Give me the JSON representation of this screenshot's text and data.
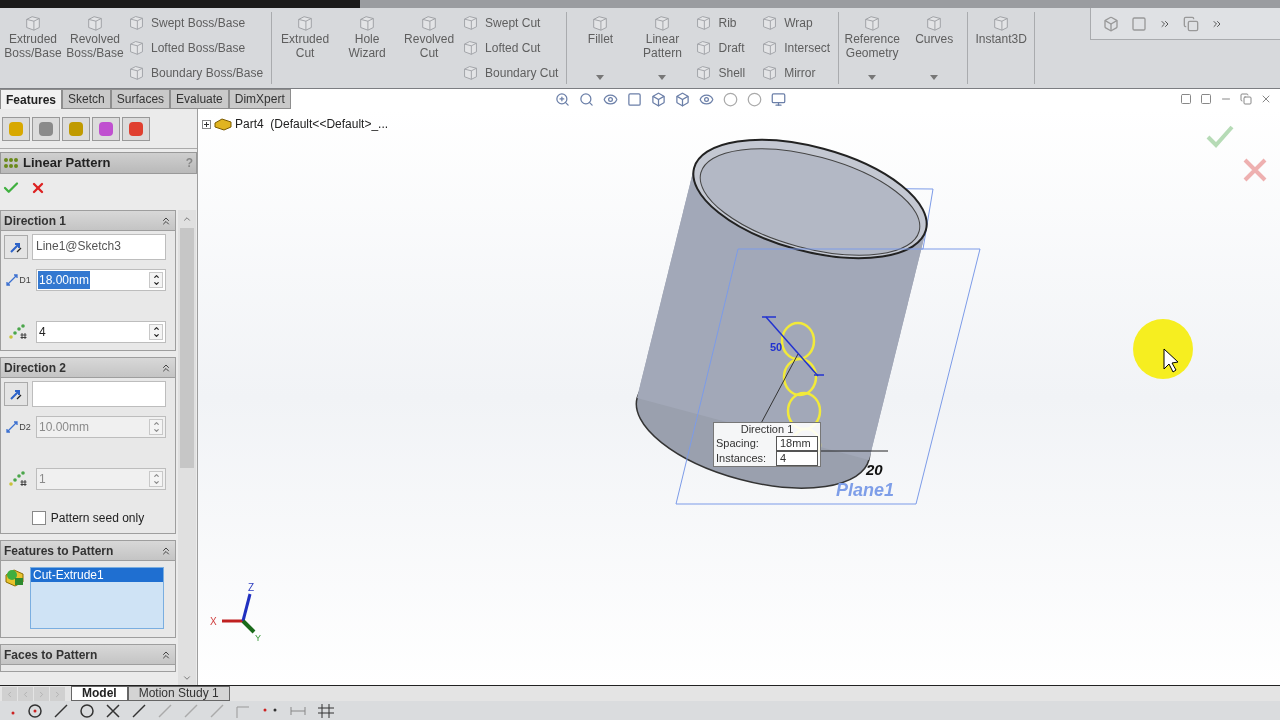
{
  "ribbon": {
    "groups": [
      {
        "items": [
          {
            "kind": "large",
            "label": "Extruded Boss/Base",
            "dropdown": false
          },
          {
            "kind": "large",
            "label": "Revolved Boss/Base",
            "dropdown": false
          },
          {
            "kind": "small",
            "label": "Swept Boss/Base"
          },
          {
            "kind": "small",
            "label": "Lofted Boss/Base"
          },
          {
            "kind": "small",
            "label": "Boundary Boss/Base"
          }
        ]
      },
      {
        "items": [
          {
            "kind": "large",
            "label": "Extruded Cut",
            "dropdown": false
          },
          {
            "kind": "large",
            "label": "Hole Wizard",
            "dropdown": false
          },
          {
            "kind": "large",
            "label": "Revolved Cut",
            "dropdown": false
          },
          {
            "kind": "small",
            "label": "Swept Cut"
          },
          {
            "kind": "small",
            "label": "Lofted Cut"
          },
          {
            "kind": "small",
            "label": "Boundary Cut"
          }
        ]
      },
      {
        "items": [
          {
            "kind": "large",
            "label": "Fillet",
            "dropdown": true
          },
          {
            "kind": "large",
            "label": "Linear Pattern",
            "dropdown": true
          },
          {
            "kind": "small",
            "label": "Rib"
          },
          {
            "kind": "small",
            "label": "Draft"
          },
          {
            "kind": "small",
            "label": "Shell"
          },
          {
            "kind": "small",
            "label": "Wrap"
          },
          {
            "kind": "small",
            "label": "Intersect"
          },
          {
            "kind": "small",
            "label": "Mirror"
          }
        ]
      },
      {
        "items": [
          {
            "kind": "large",
            "label": "Reference Geometry",
            "dropdown": true
          },
          {
            "kind": "large",
            "label": "Curves",
            "dropdown": true
          }
        ]
      },
      {
        "items": [
          {
            "kind": "large",
            "label": "Instant3D",
            "dropdown": false
          }
        ]
      }
    ]
  },
  "tabs": [
    {
      "label": "Features",
      "selected": true
    },
    {
      "label": "Sketch",
      "selected": false
    },
    {
      "label": "Surfaces",
      "selected": false
    },
    {
      "label": "Evaluate",
      "selected": false
    },
    {
      "label": "DimXpert",
      "selected": false
    }
  ],
  "tree": {
    "label": "Part4  (Default<<Default>_..."
  },
  "property_manager": {
    "title": "Linear Pattern",
    "help": "?",
    "sections": [
      {
        "kind": "direction",
        "title": "Direction 1",
        "expanded": true,
        "direction": "Line1@Sketch3",
        "icon_label": "D1",
        "spacing": "18.00mm",
        "spacing_text_selected": true,
        "instances": "4",
        "disabled": false
      },
      {
        "kind": "direction",
        "title": "Direction 2",
        "expanded": true,
        "icon_label": "D2",
        "spacing": "10.00mm",
        "spacing_text_selected": false,
        "instances": "1",
        "disabled": true,
        "checkbox": {
          "label": "Pattern seed only",
          "checked": false
        }
      },
      {
        "kind": "list",
        "title": "Features to Pattern",
        "expanded": true,
        "items": [
          {
            "label": "Cut-Extrude1",
            "selected": true
          }
        ]
      },
      {
        "kind": "header",
        "title": "Faces to Pattern",
        "expanded": true
      }
    ]
  },
  "viewport": {
    "callout": {
      "title": "Direction 1",
      "rows": [
        {
          "label": "Spacing:",
          "value": "18mm"
        },
        {
          "label": "Instances:",
          "value": "4"
        }
      ]
    },
    "dimension_1": "50",
    "dimension_2": "20",
    "plane_label": "Plane1",
    "axes": {
      "x": "X",
      "y": "Y",
      "z": "Z"
    }
  },
  "bottom_tabs": [
    {
      "label": "Model",
      "selected": true
    },
    {
      "label": "Motion Study 1",
      "selected": false
    }
  ]
}
